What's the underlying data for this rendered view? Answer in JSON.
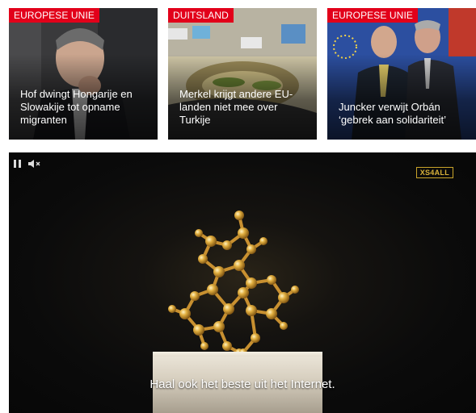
{
  "cards": [
    {
      "category": "EUROPESE UNIE",
      "headline": "Hof dwingt Hongarije en Slowakije tot opname migranten"
    },
    {
      "category": "DUITSLAND",
      "headline": "Merkel krijgt andere EU-landen niet mee over Turkije"
    },
    {
      "category": "EUROPESE UNIE",
      "headline": "Juncker verwijt Orbán ‘gebrek aan solidariteit’"
    }
  ],
  "video": {
    "pause_icon": "pause-icon",
    "mute_icon": "volume-muted-icon",
    "brand": "XS4ALL",
    "subtitle": "Haal ook het beste uit het Internet."
  },
  "colors": {
    "tag_red": "#e2001a",
    "brand_gold": "#d9b23a"
  }
}
